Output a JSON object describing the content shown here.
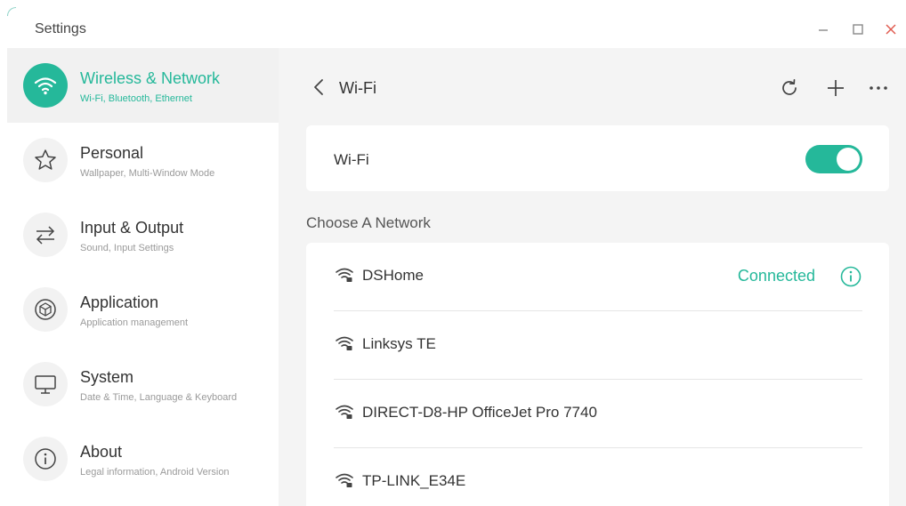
{
  "window": {
    "title": "Settings",
    "controls": [
      "minimize-icon",
      "maximize-icon",
      "close-icon"
    ],
    "close_color": "#e05b50"
  },
  "theme": {
    "accent": "#25b89a"
  },
  "sidebar": {
    "items": [
      {
        "title": "Wireless & Network",
        "subtitle": "Wi-Fi, Bluetooth, Ethernet",
        "icon": "wifi-icon",
        "active": true
      },
      {
        "title": "Personal",
        "subtitle": "Wallpaper, Multi-Window Mode",
        "icon": "star-icon",
        "active": false
      },
      {
        "title": "Input & Output",
        "subtitle": "Sound, Input Settings",
        "icon": "swap-arrows-icon",
        "active": false
      },
      {
        "title": "Application",
        "subtitle": "Application management",
        "icon": "cube-icon",
        "active": false
      },
      {
        "title": "System",
        "subtitle": "Date & Time, Language & Keyboard",
        "icon": "monitor-icon",
        "active": false
      },
      {
        "title": "About",
        "subtitle": "Legal information, Android Version",
        "icon": "info-icon",
        "active": false
      }
    ]
  },
  "main": {
    "header": {
      "title": "Wi-Fi",
      "actions": [
        "refresh-icon",
        "add-icon",
        "more-icon"
      ]
    },
    "wifi_toggle": {
      "label": "Wi-Fi",
      "on": true
    },
    "section_label": "Choose A Network",
    "networks": [
      {
        "name": "DSHome",
        "status": "Connected",
        "icon": "wifi-lock-icon"
      },
      {
        "name": "Linksys TE",
        "status": "",
        "icon": "wifi-lock-icon"
      },
      {
        "name": "DIRECT-D8-HP OfficeJet Pro 7740",
        "status": "",
        "icon": "wifi-lock-icon"
      },
      {
        "name": "TP-LINK_E34E",
        "status": "",
        "icon": "wifi-lock-icon"
      }
    ]
  }
}
